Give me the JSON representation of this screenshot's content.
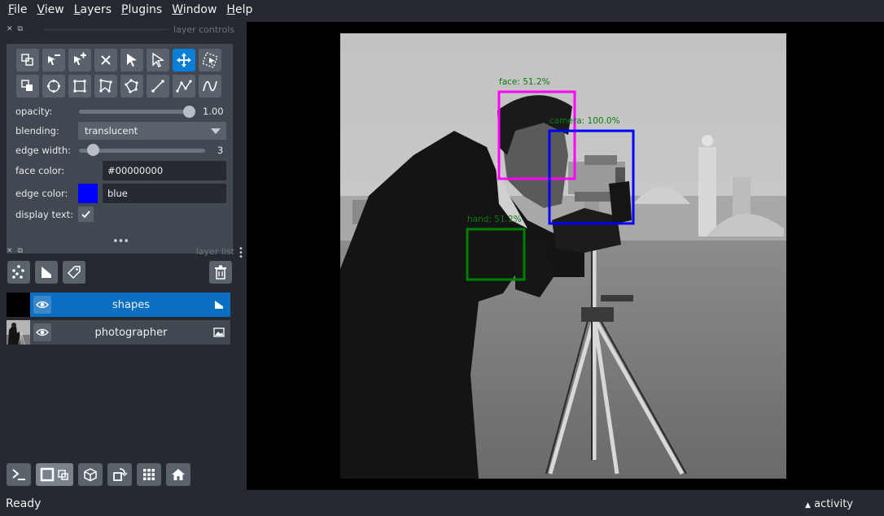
{
  "menu": [
    {
      "underline": "F",
      "rest": "ile"
    },
    {
      "underline": "V",
      "rest": "iew"
    },
    {
      "underline": "L",
      "rest": "ayers"
    },
    {
      "underline": "P",
      "rest": "lugins"
    },
    {
      "underline": "W",
      "rest": "indow"
    },
    {
      "underline": "H",
      "rest": "elp"
    }
  ],
  "layer_controls": {
    "title": "layer controls",
    "opacity": {
      "label": "opacity:",
      "value": "1.00",
      "fraction": 1.0
    },
    "blending": {
      "label": "blending:",
      "value": "translucent"
    },
    "edge_width": {
      "label": "edge width:",
      "value": "3"
    },
    "face_color": {
      "label": "face color:",
      "value": "#00000000"
    },
    "edge_color": {
      "label": "edge color:",
      "value": "blue",
      "swatch": "#0000ff"
    },
    "display_text": {
      "label": "display text:",
      "checked": true
    }
  },
  "layer_list": {
    "title": "layer list",
    "layers": [
      {
        "name": "shapes",
        "selected": true,
        "type_icon": "shapes-layer-icon"
      },
      {
        "name": "photographer",
        "selected": false,
        "type_icon": "image-layer-icon"
      }
    ]
  },
  "canvas": {
    "annotations": [
      {
        "label": "face: 51.2%",
        "color": "#ff00ff"
      },
      {
        "label": "camera: 100.0%",
        "color": "#0000ff"
      },
      {
        "label": "hand: 51.2%",
        "color": "#008000"
      }
    ]
  },
  "status": {
    "text": "Ready",
    "activity": "activity"
  },
  "colors": {
    "accent": "#0a7fd8",
    "panel": "#414851",
    "background": "#262930"
  }
}
